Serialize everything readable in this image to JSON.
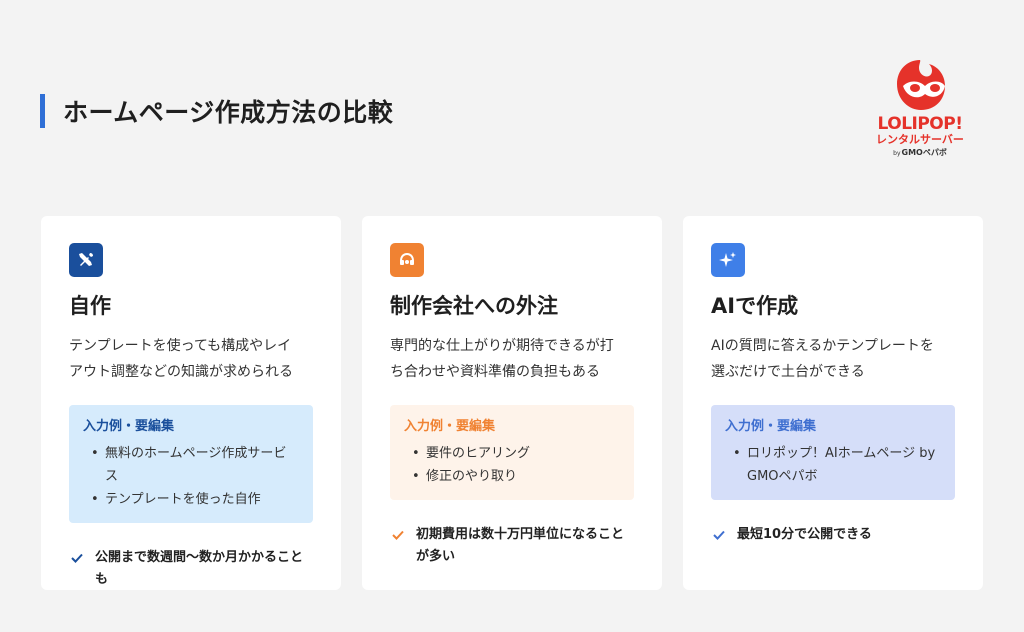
{
  "page": {
    "title": "ホームページ作成方法の比較"
  },
  "logo": {
    "word": "LOLIPOP!",
    "sub": "レンタルサーバー",
    "by": "by",
    "company": "GMOペパボ"
  },
  "colors": {
    "accent": "#2f6fd6",
    "brand": "#e5322a",
    "card1_icon": "#1a4f9c",
    "card2_icon": "#f08232",
    "card3_icon": "#3f7fe8"
  },
  "cards": [
    {
      "icon": "tools-icon",
      "title": "自作",
      "desc": [
        "テンプレートを使っても構成やレイ",
        "アウト調整などの知識が求められる"
      ],
      "example_heading": "入力例・要編集",
      "examples": [
        "無料のホームページ作成サービス",
        "テンプレートを使った自作"
      ],
      "note": "公開まで数週間〜数か月かかることも"
    },
    {
      "icon": "support-icon",
      "title": "制作会社への外注",
      "desc": [
        "専門的な仕上がりが期待できるが打",
        "ち合わせや資料準備の負担もある"
      ],
      "example_heading": "入力例・要編集",
      "examples": [
        "要件のヒアリング",
        "修正のやり取り"
      ],
      "note": "初期費用は数十万円単位になることが多い"
    },
    {
      "icon": "sparkle-icon",
      "title": "AIで作成",
      "desc": [
        "AIの質問に答えるかテンプレートを",
        "選ぶだけで土台ができる"
      ],
      "example_heading": "入力例・要編集",
      "examples": [
        "ロリポップ！AIホームページ by GMOペパボ"
      ],
      "note": "最短10分で公開できる"
    }
  ]
}
